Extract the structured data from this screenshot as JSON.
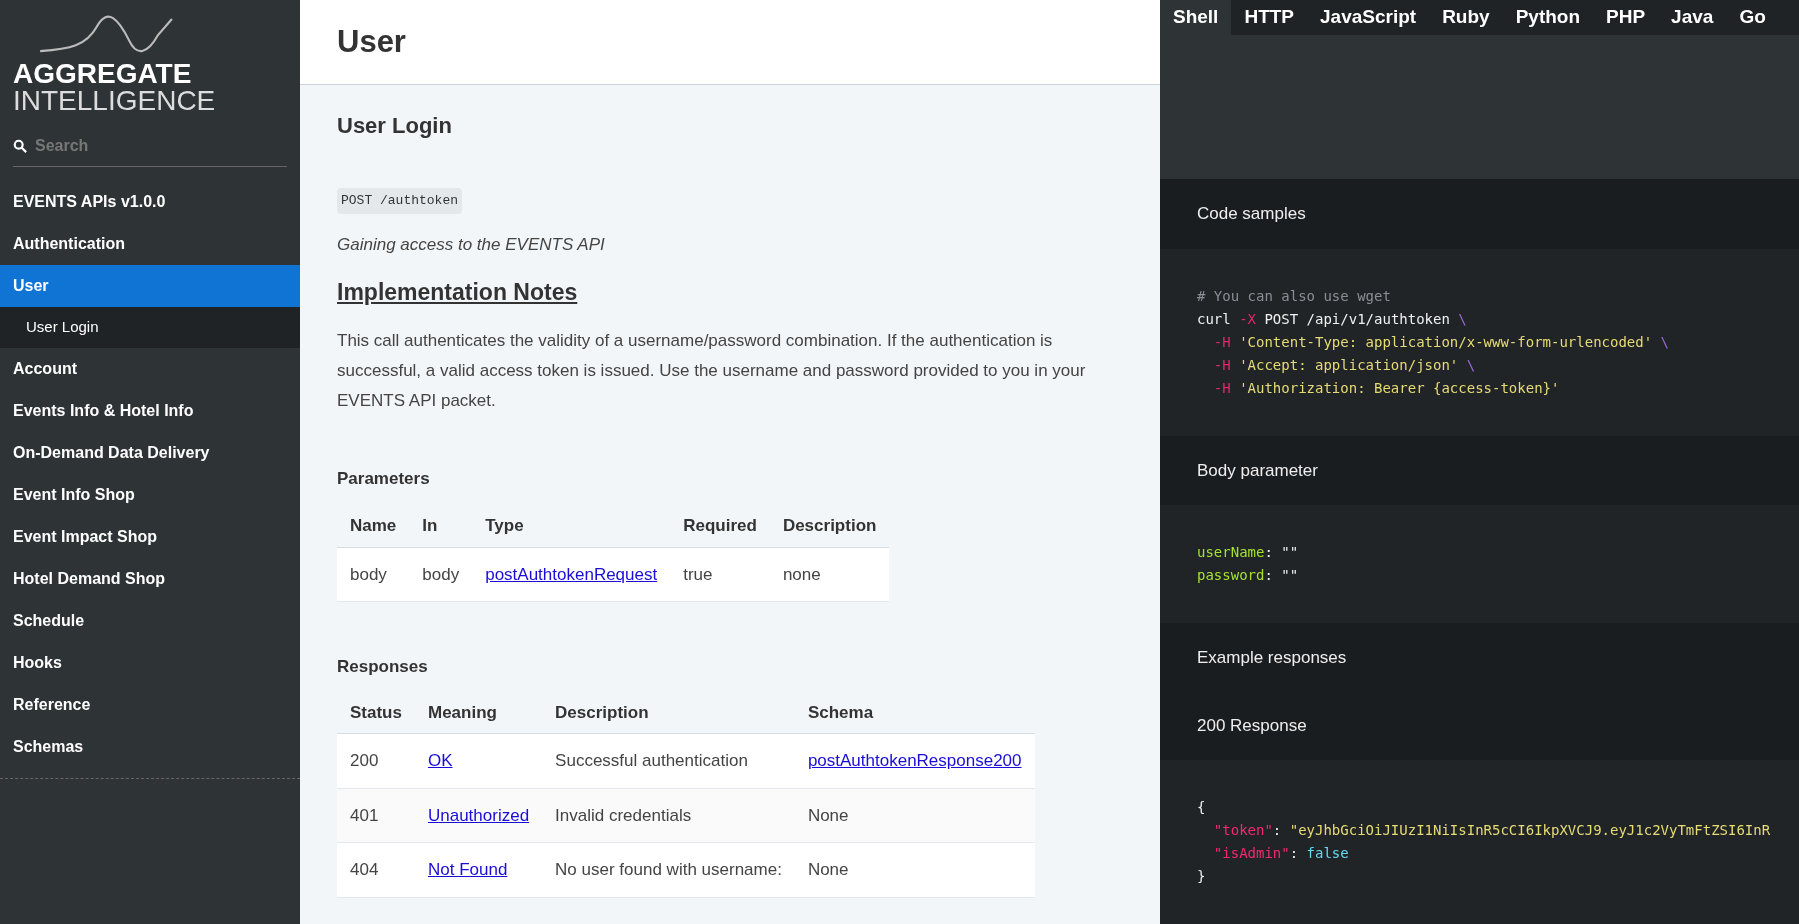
{
  "sidebar": {
    "logo": {
      "line1": "AGGREGATE",
      "line2": "INTELLIGENCE"
    },
    "search": {
      "placeholder": "Search"
    },
    "items": [
      {
        "label": "EVENTS APIs v1.0.0",
        "selected": false
      },
      {
        "label": "Authentication",
        "selected": false
      },
      {
        "label": "User",
        "selected": true,
        "children": [
          {
            "label": "User Login",
            "selected": false
          }
        ]
      },
      {
        "label": "Account",
        "selected": false
      },
      {
        "label": "Events Info & Hotel Info",
        "selected": false
      },
      {
        "label": "On-Demand Data Delivery",
        "selected": false
      },
      {
        "label": "Event Info Shop",
        "selected": false
      },
      {
        "label": "Event Impact Shop",
        "selected": false
      },
      {
        "label": "Hotel Demand Shop",
        "selected": false
      },
      {
        "label": "Schedule",
        "selected": false
      },
      {
        "label": "Hooks",
        "selected": false
      },
      {
        "label": "Reference",
        "selected": false
      },
      {
        "label": "Schemas",
        "selected": false
      }
    ]
  },
  "main": {
    "page_title": "User",
    "section_title": "User Login",
    "endpoint": "POST /authtoken",
    "summary": "Gaining access to the EVENTS API",
    "notes_title": "Implementation Notes",
    "notes": "This call authenticates the validity of a username/password combination. If the authentication is successful, a valid access token is issued. Use the username and password provided to you in your EVENTS API packet.",
    "parameters": {
      "title": "Parameters",
      "columns": [
        "Name",
        "In",
        "Type",
        "Required",
        "Description"
      ],
      "rows": [
        [
          {
            "text": "body",
            "link": false
          },
          {
            "text": "body",
            "link": false
          },
          {
            "text": "postAuthtokenRequest",
            "link": true
          },
          {
            "text": "true",
            "link": false
          },
          {
            "text": "none",
            "link": false
          }
        ]
      ]
    },
    "responses": {
      "title": "Responses",
      "columns": [
        "Status",
        "Meaning",
        "Description",
        "Schema"
      ],
      "rows": [
        [
          {
            "text": "200",
            "link": false
          },
          {
            "text": "OK",
            "link": true
          },
          {
            "text": "Successful authentication",
            "link": false
          },
          {
            "text": "postAuthtokenResponse200",
            "link": true
          }
        ],
        [
          {
            "text": "401",
            "link": false
          },
          {
            "text": "Unauthorized",
            "link": true
          },
          {
            "text": "Invalid credentials",
            "link": false
          },
          {
            "text": "None",
            "link": false
          }
        ],
        [
          {
            "text": "404",
            "link": false
          },
          {
            "text": "Not Found",
            "link": true
          },
          {
            "text": "No user found with username:",
            "link": false
          },
          {
            "text": "None",
            "link": false
          }
        ]
      ]
    }
  },
  "code_panel": {
    "tabs": [
      {
        "label": "Shell",
        "selected": true
      },
      {
        "label": "HTTP",
        "selected": false
      },
      {
        "label": "JavaScript",
        "selected": false
      },
      {
        "label": "Ruby",
        "selected": false
      },
      {
        "label": "Python",
        "selected": false
      },
      {
        "label": "PHP",
        "selected": false
      },
      {
        "label": "Java",
        "selected": false
      },
      {
        "label": "Go",
        "selected": false
      }
    ],
    "sections": [
      {
        "headings": [
          "Code samples"
        ],
        "code": [
          [
            {
              "kind": "comment",
              "text": "# You can also use wget"
            }
          ],
          [
            {
              "kind": "plain",
              "text": "curl "
            },
            {
              "kind": "flag",
              "text": "-X"
            },
            {
              "kind": "plain",
              "text": " POST /api/v1/authtoken "
            },
            {
              "kind": "punct",
              "text": "\\"
            }
          ],
          [
            {
              "kind": "flag",
              "text": "-H"
            },
            {
              "kind": "string",
              "text": " 'Content-Type: application/x-www-form-urlencoded'"
            },
            {
              "kind": "punct",
              "text": " \\"
            }
          ],
          [
            {
              "kind": "flag",
              "text": "-H"
            },
            {
              "kind": "string",
              "text": " 'Accept: application/json'"
            },
            {
              "kind": "punct",
              "text": " \\"
            }
          ],
          [
            {
              "kind": "flag",
              "text": "-H"
            },
            {
              "kind": "string",
              "text": " 'Authorization: Bearer {access-token}'"
            }
          ]
        ]
      },
      {
        "headings": [
          "Body parameter"
        ],
        "code": [
          [
            {
              "kind": "key",
              "text": "userName"
            },
            {
              "kind": "plain",
              "text": ": \"\""
            }
          ],
          [
            {
              "kind": "key",
              "text": "password"
            },
            {
              "kind": "plain",
              "text": ": \"\""
            }
          ]
        ]
      },
      {
        "headings": [
          "Example responses",
          "200 Response"
        ],
        "code": [
          [
            {
              "kind": "plain",
              "text": "{"
            }
          ],
          [
            {
              "kind": "prop",
              "text": "\"token\""
            },
            {
              "kind": "plain",
              "text": ": "
            },
            {
              "kind": "string",
              "text": "\"eyJhbGciOiJIUzI1NiIsInR5cCI6IkpXVCJ9.eyJ1c2VyTmFtZSI6InR"
            }
          ],
          [
            {
              "kind": "prop",
              "text": "\"isAdmin\""
            },
            {
              "kind": "plain",
              "text": ": "
            },
            {
              "kind": "bool",
              "text": "false"
            }
          ],
          [
            {
              "kind": "plain",
              "text": "}"
            }
          ]
        ]
      }
    ]
  }
}
